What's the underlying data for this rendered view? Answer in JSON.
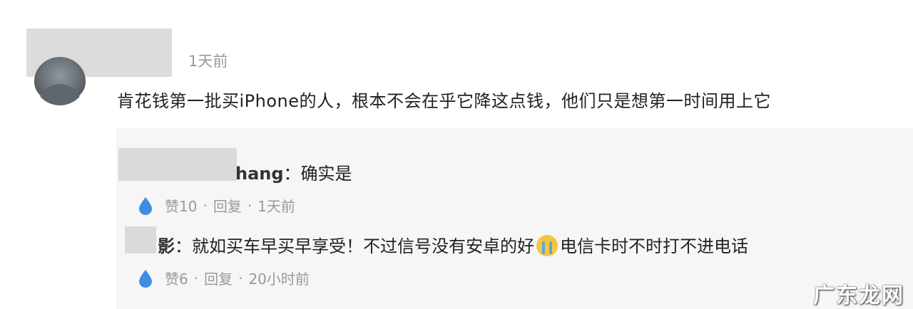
{
  "comment": {
    "time": "1天前",
    "text": "肯花钱第一批买iPhone的人，根本不会在乎它降这点钱，他们只是想第一时间用上它"
  },
  "replies": [
    {
      "name": "hang",
      "colon": "：",
      "text": "确实是",
      "like_label": "赞10",
      "reply_label": "回复",
      "time": "1天前",
      "separator": "·"
    },
    {
      "name": "影",
      "colon": "：",
      "text_before": "就如买车早买早享受！不过信号没有安卓的好",
      "emoji": "crying-emoji",
      "text_after": "电信卡时不时打不进电话",
      "like_label": "赞6",
      "reply_label": "回复",
      "time": "20小时前",
      "separator": "·"
    }
  ],
  "watermark": "广东龙网",
  "colors": {
    "meta_gray": "#999999",
    "reply_bg": "#f6f6f7",
    "like_icon_blue": "#3d8ee3"
  }
}
